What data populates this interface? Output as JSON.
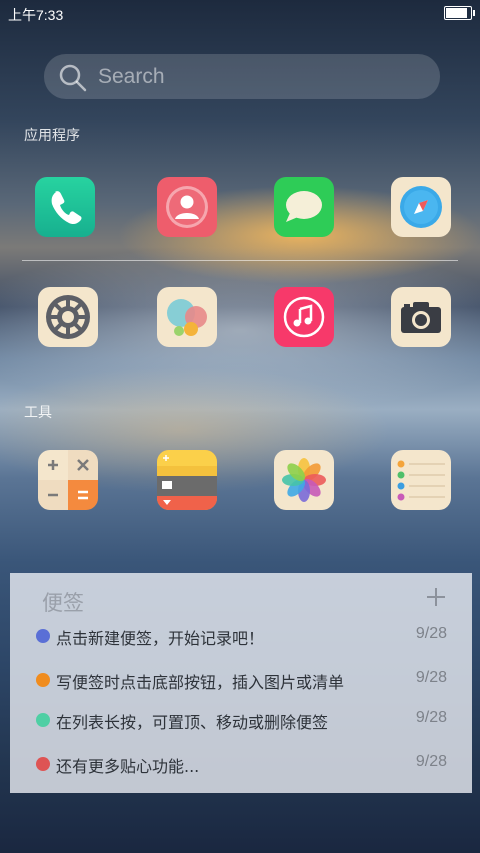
{
  "status_bar": {
    "time": "上午7:33",
    "battery_level": 0.95
  },
  "search": {
    "placeholder": "Search",
    "icon": "search-icon"
  },
  "sections": {
    "apps_label": "应用程序",
    "tools_label": "工具"
  },
  "apps": [
    {
      "name": "phone",
      "icon": "phone-icon",
      "color": "#22c49a"
    },
    {
      "name": "contacts",
      "icon": "contacts-icon",
      "color": "#ee5d6c"
    },
    {
      "name": "messages",
      "icon": "message-bubble-icon",
      "color": "#2ecc57"
    },
    {
      "name": "browser",
      "icon": "compass-icon",
      "color": "#f4e6cc"
    },
    {
      "name": "settings",
      "icon": "gear-icon",
      "color": "#f4e6cc"
    },
    {
      "name": "game-center",
      "icon": "circles-icon",
      "color": "#f4e6cc"
    },
    {
      "name": "music",
      "icon": "music-note-icon",
      "color": "#f7396a"
    },
    {
      "name": "camera",
      "icon": "camera-icon",
      "color": "#f4e6cc"
    }
  ],
  "tools": [
    {
      "name": "calculator",
      "icon": "calculator-icon"
    },
    {
      "name": "wallet",
      "icon": "wallet-icon"
    },
    {
      "name": "photos",
      "icon": "photos-flower-icon"
    },
    {
      "name": "reminders",
      "icon": "list-icon"
    }
  ],
  "notes_widget": {
    "title": "便签",
    "add_icon": "plus-icon",
    "items": [
      {
        "text": "点击新建便签，开始记录吧！",
        "date": "9/28",
        "dot_color": "#5a6fd6"
      },
      {
        "text": "写便签时点击底部按钮，插入图片或清单",
        "date": "9/28",
        "dot_color": "#f08c1e"
      },
      {
        "text": "在列表长按，可置顶、移动或删除便签",
        "date": "9/28",
        "dot_color": "#4fcfa4"
      },
      {
        "text": "还有更多贴心功能...",
        "date": "9/28",
        "dot_color": "#de5454"
      }
    ]
  }
}
